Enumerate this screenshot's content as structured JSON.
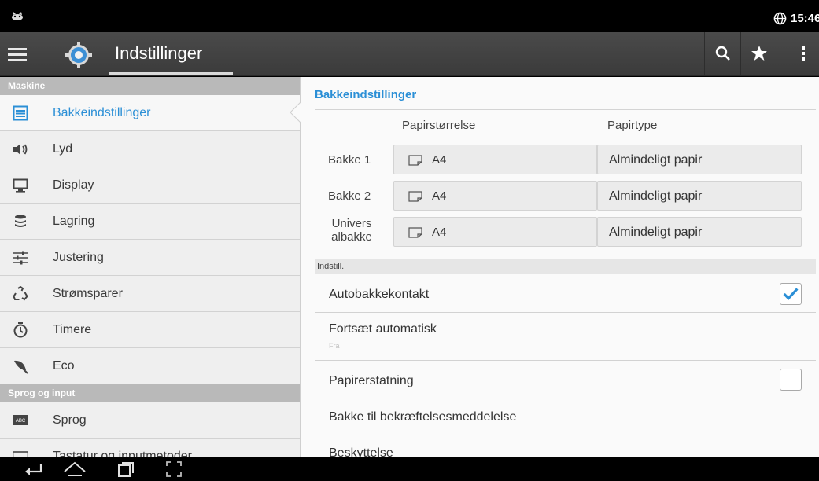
{
  "status": {
    "time": "15:46"
  },
  "header": {
    "title": "Indstillinger"
  },
  "sidebar": {
    "sections": [
      {
        "title": "Maskine",
        "items": [
          {
            "label": "Bakkeindstillinger",
            "icon": "tray-list-icon"
          },
          {
            "label": "Lyd",
            "icon": "speaker-icon"
          },
          {
            "label": "Display",
            "icon": "monitor-icon"
          },
          {
            "label": "Lagring",
            "icon": "storage-icon"
          },
          {
            "label": "Justering",
            "icon": "sliders-icon"
          },
          {
            "label": "Strømsparer",
            "icon": "recycle-icon"
          },
          {
            "label": "Timere",
            "icon": "stopwatch-icon"
          },
          {
            "label": "Eco",
            "icon": "leaf-icon"
          }
        ]
      },
      {
        "title": "Sprog og input",
        "items": [
          {
            "label": "Sprog",
            "icon": "abc-keyboard-icon"
          },
          {
            "label": "Tastatur og inputmetoder",
            "icon": "keyboard-icon"
          }
        ]
      }
    ]
  },
  "main": {
    "title": "Bakkeindstillinger",
    "columns": {
      "size": "Papirstørrelse",
      "type": "Papirtype"
    },
    "trays": [
      {
        "label": "Bakke 1",
        "size": "A4",
        "type": "Almindeligt papir"
      },
      {
        "label": "Bakke 2",
        "size": "A4",
        "type": "Almindeligt papir"
      },
      {
        "label": "Univers albakke",
        "label_line1": "Univers",
        "label_line2": "albakke",
        "size": "A4",
        "type": "Almindeligt papir"
      }
    ],
    "settings_section": "Indstill.",
    "settings": [
      {
        "label": "Autobakkekontakt",
        "checked": true
      },
      {
        "label": "Fortsæt automatisk",
        "sub": "Fra"
      },
      {
        "label": "Papirerstatning",
        "checked": false
      },
      {
        "label": "Bakke til bekræftelsesmeddelelse"
      },
      {
        "label": "Beskyttelse"
      }
    ]
  },
  "colors": {
    "accent": "#2b8fd6",
    "actionbar": "#444444",
    "checkmark": "#2b8fd6"
  }
}
